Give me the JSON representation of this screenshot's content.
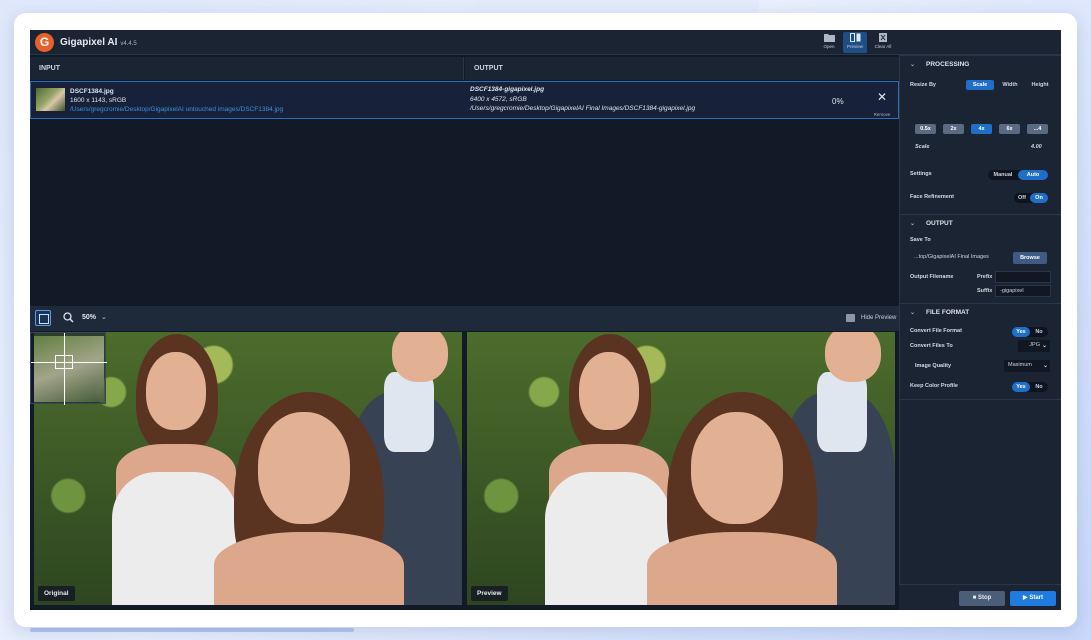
{
  "app": {
    "title": "Gigapixel AI",
    "version": "v4.4.5",
    "logo_letter": "G"
  },
  "toolbar": [
    {
      "label": "Open",
      "icon": "folder-icon"
    },
    {
      "label": "Preview",
      "icon": "split-view-icon",
      "active": true
    },
    {
      "label": "Clear All",
      "icon": "clear-all-icon"
    }
  ],
  "columns": {
    "input": "INPUT",
    "output": "OUTPUT"
  },
  "file": {
    "input_name": "DSCF1384.jpg",
    "input_info": "1600 x 1143, sRGB",
    "input_path": "/Users/gregcromie/Desktop/GigapixelAI untouched images/DSCF1384.jpg",
    "output_name": "DSCF1384-gigapixel.jpg",
    "output_info": "6400 x 4572, sRGB",
    "output_path": "/Users/gregcromie/Desktop/GigapixelAI Final Images/DSCF1384-gigapixel.jpg",
    "progress": "0%",
    "remove_label": "Remove"
  },
  "preview_bar": {
    "zoom": "50%",
    "hide_label": "Hide Preview"
  },
  "preview": {
    "original_tag": "Original",
    "preview_tag": "Preview"
  },
  "sidebar": {
    "processing": {
      "title": "PROCESSING",
      "resize_label": "Resize By",
      "resize_options": [
        "Scale",
        "Width",
        "Height"
      ],
      "resize_selected": "Scale",
      "scale_chips": [
        "0.5x",
        "2x",
        "4x",
        "6x",
        "...4"
      ],
      "scale_selected": "4x",
      "scale_label": "Scale",
      "scale_value": "4.00",
      "settings_label": "Settings",
      "settings_options": [
        "Manual",
        "Auto"
      ],
      "settings_selected": "Auto",
      "face_label": "Face Refinement",
      "face_options": [
        "Off",
        "On"
      ],
      "face_selected": "On"
    },
    "output": {
      "title": "OUTPUT",
      "save_label": "Save To",
      "save_path": "...top/GigapixelAI Final Images",
      "browse_label": "Browse",
      "filename_label": "Output Filename",
      "prefix_label": "Prefix",
      "prefix_value": "",
      "suffix_label": "Suffix",
      "suffix_value": "-gigapixel"
    },
    "file_format": {
      "title": "FILE FORMAT",
      "convert_label": "Convert File Format",
      "convert_options": [
        "Yes",
        "No"
      ],
      "convert_selected": "Yes",
      "convert_to_label": "Convert Files To",
      "convert_to_value": "JPG",
      "quality_label": "Image Quality",
      "quality_value": "Maximum",
      "color_label": "Keep Color Profile",
      "color_options": [
        "Yes",
        "No"
      ],
      "color_selected": "Yes"
    }
  },
  "actions": {
    "stop": "Stop",
    "start": "Start"
  },
  "colors": {
    "accent": "#1f6fc9",
    "background": "#121a28",
    "panel": "#1b2433",
    "logo": "#e8602c"
  }
}
